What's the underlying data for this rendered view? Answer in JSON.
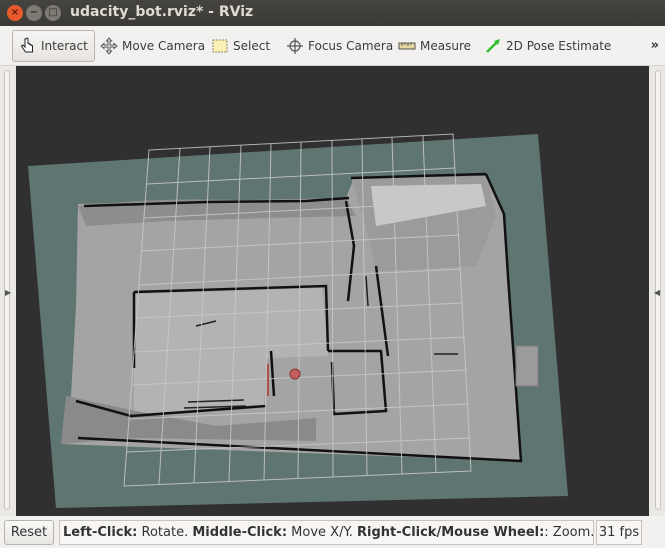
{
  "window": {
    "title": "udacity_bot.rviz* - RViz",
    "close_glyph": "×",
    "minimize_glyph": "−",
    "maximize_glyph": "□"
  },
  "toolbar": {
    "tools": [
      {
        "label": "Interact",
        "icon": "hand-pointer-icon",
        "active": true
      },
      {
        "label": "Move Camera",
        "icon": "move-camera-icon",
        "active": false
      },
      {
        "label": "Select",
        "icon": "select-rect-icon",
        "active": false
      },
      {
        "label": "Focus Camera",
        "icon": "focus-crosshair-icon",
        "active": false
      },
      {
        "label": "Measure",
        "icon": "ruler-icon",
        "active": false
      },
      {
        "label": "2D Pose Estimate",
        "icon": "pose-arrow-icon",
        "active": false
      }
    ],
    "overflow_label": "»"
  },
  "viewport": {
    "background_color": "#303030",
    "map_border_color": "#5f7572",
    "map_free_color": "#a4a4a4",
    "grid_color": "#c9c9c9"
  },
  "statusbar": {
    "reset_label": "Reset",
    "hint": {
      "left_key": "Left-Click:",
      "left_action": " Rotate. ",
      "middle_key": "Middle-Click:",
      "middle_action": " Move X/Y. ",
      "right_key": "Right-Click/Mouse Wheel:",
      "right_action": ": Zoom. S"
    },
    "fps": "31 fps"
  }
}
